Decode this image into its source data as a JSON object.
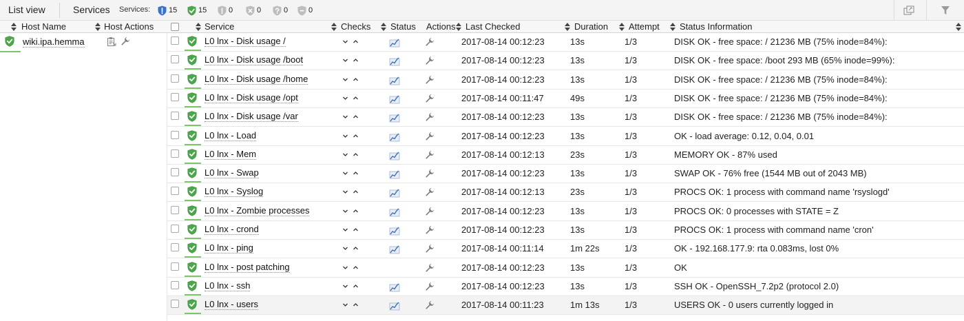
{
  "toolbar": {
    "list_view_label": "List view",
    "services_label": "Services",
    "services_summary_label": "Services:",
    "summary": [
      {
        "icon": "shield-blue-icon",
        "count": "15",
        "color": "#3a73c8"
      },
      {
        "icon": "shield-green-icon",
        "count": "15",
        "color": "#4ca64c"
      },
      {
        "icon": "shield-warning-icon",
        "count": "0",
        "color": "#bdbdbd"
      },
      {
        "icon": "shield-critical-icon",
        "count": "0",
        "color": "#bdbdbd"
      },
      {
        "icon": "shield-unknown-icon",
        "count": "0",
        "color": "#bdbdbd"
      },
      {
        "icon": "shield-pending-icon",
        "count": "0",
        "color": "#bdbdbd"
      }
    ]
  },
  "columns": {
    "host_name": "Host Name",
    "host_actions": "Host Actions",
    "service": "Service",
    "checks": "Checks",
    "status": "Status",
    "actions": "Actions",
    "last_checked": "Last Checked",
    "duration": "Duration",
    "attempt": "Attempt",
    "status_information": "Status Information"
  },
  "host": {
    "name": "wiki.ipa.hemma",
    "status_color": "#4ca64c"
  },
  "rows": [
    {
      "service": "L0 lnx - Disk usage /",
      "last_checked": "2017-08-14 00:12:23",
      "duration": "13s",
      "attempt": "1/3",
      "info": "DISK OK - free space: / 21236 MB (75% inode=84%):",
      "graph": true
    },
    {
      "service": "L0 lnx - Disk usage /boot",
      "last_checked": "2017-08-14 00:12:23",
      "duration": "13s",
      "attempt": "1/3",
      "info": "DISK OK - free space: /boot 293 MB (65% inode=99%):",
      "graph": true
    },
    {
      "service": "L0 lnx - Disk usage /home",
      "last_checked": "2017-08-14 00:12:23",
      "duration": "13s",
      "attempt": "1/3",
      "info": "DISK OK - free space: / 21236 MB (75% inode=84%):",
      "graph": true
    },
    {
      "service": "L0 lnx - Disk usage /opt",
      "last_checked": "2017-08-14 00:11:47",
      "duration": "49s",
      "attempt": "1/3",
      "info": "DISK OK - free space: / 21236 MB (75% inode=84%):",
      "graph": true
    },
    {
      "service": "L0 lnx - Disk usage /var",
      "last_checked": "2017-08-14 00:12:23",
      "duration": "13s",
      "attempt": "1/3",
      "info": "DISK OK - free space: / 21236 MB (75% inode=84%):",
      "graph": true
    },
    {
      "service": "L0 lnx - Load",
      "last_checked": "2017-08-14 00:12:23",
      "duration": "13s",
      "attempt": "1/3",
      "info": "OK - load average: 0.12, 0.04, 0.01",
      "graph": true
    },
    {
      "service": "L0 lnx - Mem",
      "last_checked": "2017-08-14 00:12:13",
      "duration": "23s",
      "attempt": "1/3",
      "info": "MEMORY OK - 87% used",
      "graph": true
    },
    {
      "service": "L0 lnx - Swap",
      "last_checked": "2017-08-14 00:12:23",
      "duration": "13s",
      "attempt": "1/3",
      "info": "SWAP OK - 76% free (1544 MB out of 2043 MB)",
      "graph": true
    },
    {
      "service": "L0 lnx - Syslog",
      "last_checked": "2017-08-14 00:12:13",
      "duration": "23s",
      "attempt": "1/3",
      "info": "PROCS OK: 1 process with command name 'rsyslogd'",
      "graph": true
    },
    {
      "service": "L0 lnx - Zombie processes",
      "last_checked": "2017-08-14 00:12:23",
      "duration": "13s",
      "attempt": "1/3",
      "info": "PROCS OK: 0 processes with STATE = Z",
      "graph": true
    },
    {
      "service": "L0 lnx - crond",
      "last_checked": "2017-08-14 00:12:23",
      "duration": "13s",
      "attempt": "1/3",
      "info": "PROCS OK: 1 process with command name 'cron'",
      "graph": true
    },
    {
      "service": "L0 lnx - ping",
      "last_checked": "2017-08-14 00:11:14",
      "duration": "1m 22s",
      "attempt": "1/3",
      "info": "OK - 192.168.177.9: rta 0.083ms, lost 0%",
      "graph": true
    },
    {
      "service": "L0 lnx - post patching",
      "last_checked": "2017-08-14 00:12:23",
      "duration": "13s",
      "attempt": "1/3",
      "info": "OK",
      "graph": false
    },
    {
      "service": "L0 lnx - ssh",
      "last_checked": "2017-08-14 00:12:23",
      "duration": "13s",
      "attempt": "1/3",
      "info": "SSH OK - OpenSSH_7.2p2 (protocol 2.0)",
      "graph": true
    },
    {
      "service": "L0 lnx - users",
      "last_checked": "2017-08-14 00:11:23",
      "duration": "1m 13s",
      "attempt": "1/3",
      "info": "USERS OK - 0 users currently logged in",
      "graph": true
    }
  ]
}
